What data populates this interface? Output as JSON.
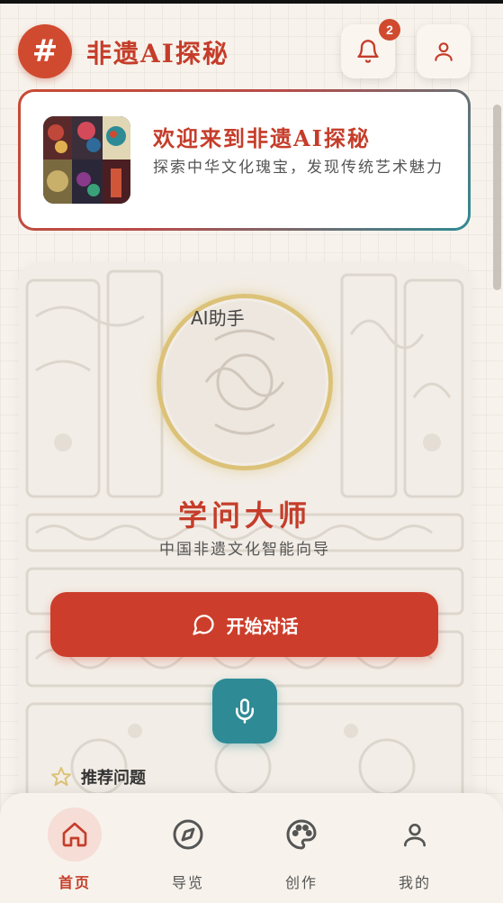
{
  "header": {
    "logo_symbol": "#",
    "app_title": "非遗AI探秘",
    "notification_count": "2"
  },
  "welcome": {
    "title": "欢迎来到非遗AI探秘",
    "subtitle": "探索中华文化瑰宝，发现传统艺术魅力"
  },
  "assistant": {
    "portrait_alt": "AI助手",
    "name": "学问大师",
    "description": "中国非遗文化智能向导",
    "start_label": "开始对话",
    "recommended_label": "推荐问题"
  },
  "nav": {
    "items": [
      {
        "label": "首页",
        "icon": "home-icon",
        "active": true
      },
      {
        "label": "导览",
        "icon": "compass-icon",
        "active": false
      },
      {
        "label": "创作",
        "icon": "palette-icon",
        "active": false
      },
      {
        "label": "我的",
        "icon": "user-icon",
        "active": false
      }
    ]
  },
  "colors": {
    "primary": "#cc3e2b",
    "teal": "#2e8b95",
    "gold": "#dcc278",
    "background": "#f7f3ec"
  }
}
